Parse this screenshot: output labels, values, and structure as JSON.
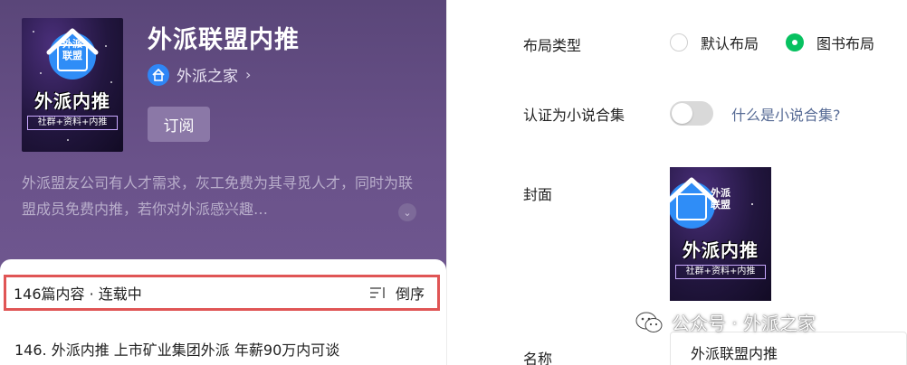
{
  "account": {
    "title": "外派联盟内推",
    "brand_name": "外派之家",
    "subscribe_label": "订阅",
    "description": "外派盟友公司有人才需求，灰工免费为其寻觅人才，同时为联盟成员免费内推，若你对外派感兴趣…"
  },
  "cover": {
    "house_text_1": "外派",
    "house_text_2": "联盟",
    "title": "外派内推",
    "tagline": "社群+资料+内推"
  },
  "list": {
    "count_label": "146篇内容 · 连载中",
    "sort_label": "倒序",
    "first_item": "146. 外派内推 上市矿业集团外派 年薪90万内可谈"
  },
  "form": {
    "layout_label": "布局类型",
    "layout_options": [
      "默认布局",
      "图书布局"
    ],
    "layout_selected": "图书布局",
    "novel_label": "认证为小说合集",
    "novel_help": "什么是小说合集?",
    "cover_label": "封面",
    "name_label": "名称",
    "name_value": "外派联盟内推"
  },
  "watermark": {
    "text": "公众号 · 外派之家"
  },
  "colors": {
    "panel": "#6a528a",
    "accent_green": "#07c160",
    "link_blue": "#576b95",
    "highlight_red": "#e05555"
  }
}
